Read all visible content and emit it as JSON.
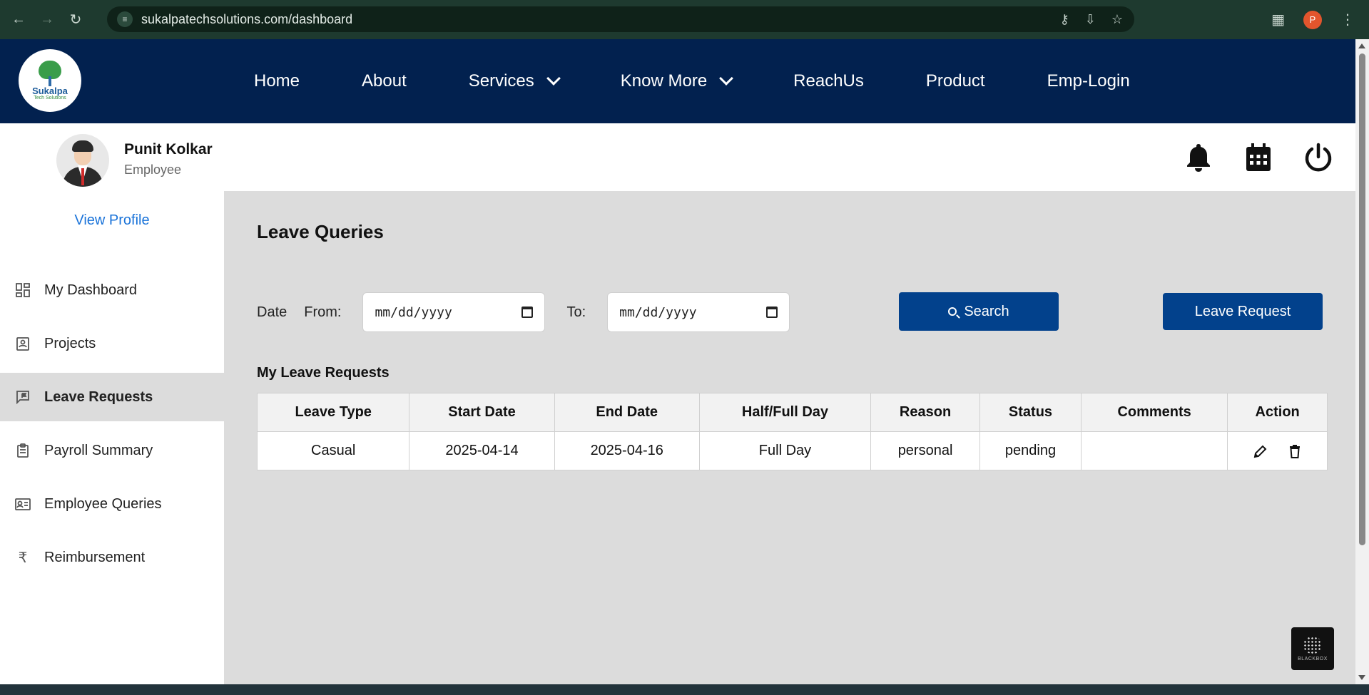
{
  "browser": {
    "url": "sukalpatechsolutions.com/dashboard",
    "profile_initial": "P"
  },
  "site": {
    "logo_name": "Sukalpa",
    "logo_tagline": "Tech Solutions",
    "nav": [
      {
        "label": "Home"
      },
      {
        "label": "About"
      },
      {
        "label": "Services",
        "dropdown": true
      },
      {
        "label": "Know More",
        "dropdown": true
      },
      {
        "label": "ReachUs"
      },
      {
        "label": "Product"
      },
      {
        "label": "Emp-Login"
      }
    ]
  },
  "user": {
    "name": "Punit Kolkar",
    "role": "Employee",
    "view_profile": "View Profile"
  },
  "sidebar": {
    "items": [
      {
        "label": "My Dashboard",
        "icon": "dashboard-icon"
      },
      {
        "label": "Projects",
        "icon": "projects-icon"
      },
      {
        "label": "Leave Requests",
        "icon": "leave-requests-icon",
        "active": true
      },
      {
        "label": "Payroll Summary",
        "icon": "payroll-icon"
      },
      {
        "label": "Employee Queries",
        "icon": "employee-queries-icon"
      },
      {
        "label": "Reimbursement",
        "icon": "rupee-icon"
      }
    ]
  },
  "main": {
    "title": "Leave Queries",
    "filter": {
      "date_label": "Date",
      "from_label": "From:",
      "from_placeholder": "mm/dd/yyyy",
      "to_label": "To:",
      "to_placeholder": "mm/dd/yyyy",
      "search_label": "Search",
      "leave_request_label": "Leave Request"
    },
    "table": {
      "title": "My Leave Requests",
      "columns": [
        "Leave Type",
        "Start Date",
        "End Date",
        "Half/Full Day",
        "Reason",
        "Status",
        "Comments",
        "Action"
      ],
      "rows": [
        {
          "leave_type": "Casual",
          "start_date": "2025-04-14",
          "end_date": "2025-04-16",
          "day_type": "Full Day",
          "reason": "personal",
          "status": "pending",
          "comments": ""
        }
      ]
    }
  },
  "colors": {
    "header_bg": "#02214f",
    "primary_button": "#02418c",
    "content_bg": "#dcdcdc",
    "link": "#1a73d9"
  },
  "badge": {
    "text": "BLACKBOX"
  }
}
